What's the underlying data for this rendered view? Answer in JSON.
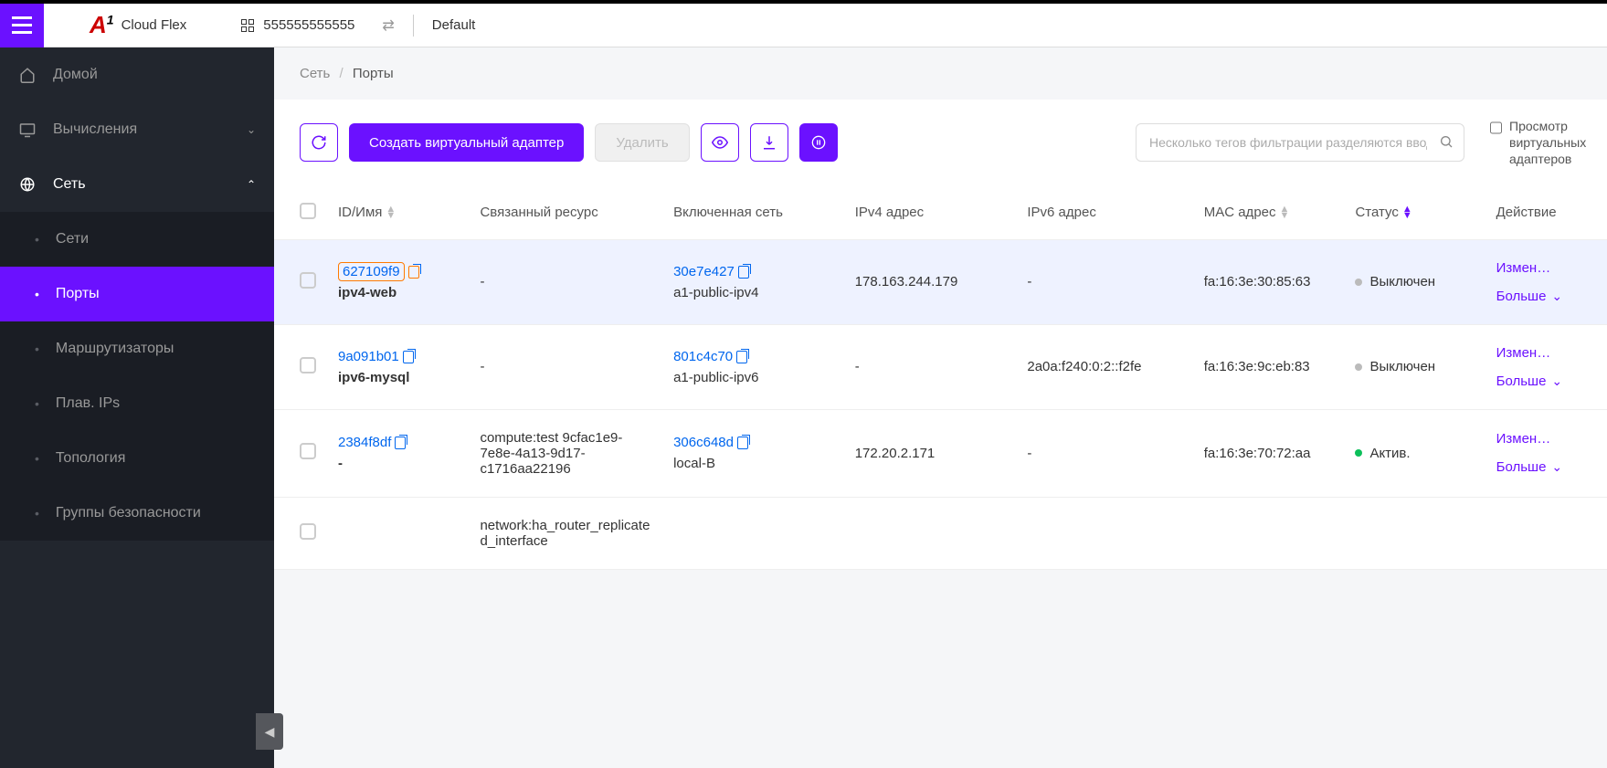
{
  "brand": {
    "logo_text": "Cloud Flex"
  },
  "topbar": {
    "account_id": "555555555555",
    "project": "Default"
  },
  "sidebar": {
    "home": "Домой",
    "compute": "Вычисления",
    "network": "Сеть",
    "sub": {
      "networks": "Сети",
      "ports": "Порты",
      "routers": "Маршрутизаторы",
      "floating": "Плав. IPs",
      "topology": "Топология",
      "secgroups": "Группы безопасности"
    }
  },
  "breadcrumb": {
    "root": "Сеть",
    "current": "Порты"
  },
  "toolbar": {
    "create": "Создать виртуальный адаптер",
    "delete": "Удалить",
    "search_ph": "Несколько тегов фильтрации разделяются вводом",
    "view_toggle": "Просмотр виртуальных адаптеров"
  },
  "table": {
    "headers": {
      "id_name": "ID/Имя",
      "resource": "Связанный ресурс",
      "net": "Включенная сеть",
      "ipv4": "IPv4 адрес",
      "ipv6": "IPv6 адрес",
      "mac": "MAC адрес",
      "status": "Статус",
      "action": "Действие"
    },
    "action_edit": "Измен…",
    "action_more": "Больше",
    "status_off": "Выключен",
    "status_on": "Актив.",
    "rows": [
      {
        "id": "627109f9",
        "highlighted": true,
        "name": "ipv4-web",
        "resource": "-",
        "net_id": "30e7e427",
        "net_name": "a1-public-ipv4",
        "ipv4": "178.163.244.179",
        "ipv6": "-",
        "mac": "fa:16:3e:30:85:63",
        "status": "off"
      },
      {
        "id": "9a091b01",
        "highlighted": false,
        "name": "ipv6-mysql",
        "resource": "-",
        "net_id": "801c4c70",
        "net_name": "a1-public-ipv6",
        "ipv4": "-",
        "ipv6": "2a0a:f240:0:2::f2fe",
        "mac": "fa:16:3e:9c:eb:83",
        "status": "off"
      },
      {
        "id": "2384f8df",
        "highlighted": false,
        "name": "-",
        "resource": "compute:test 9cfac1e9-7e8e-4a13-9d17-c1716aa22196",
        "net_id": "306c648d",
        "net_name": "local-B",
        "ipv4": "172.20.2.171",
        "ipv6": "-",
        "mac": "fa:16:3e:70:72:aa",
        "status": "on"
      },
      {
        "id": "",
        "highlighted": false,
        "name": "",
        "resource": "network:ha_router_replicated_interface",
        "net_id": "",
        "net_name": "",
        "ipv4": "",
        "ipv6": "",
        "mac": "",
        "status": ""
      }
    ]
  }
}
